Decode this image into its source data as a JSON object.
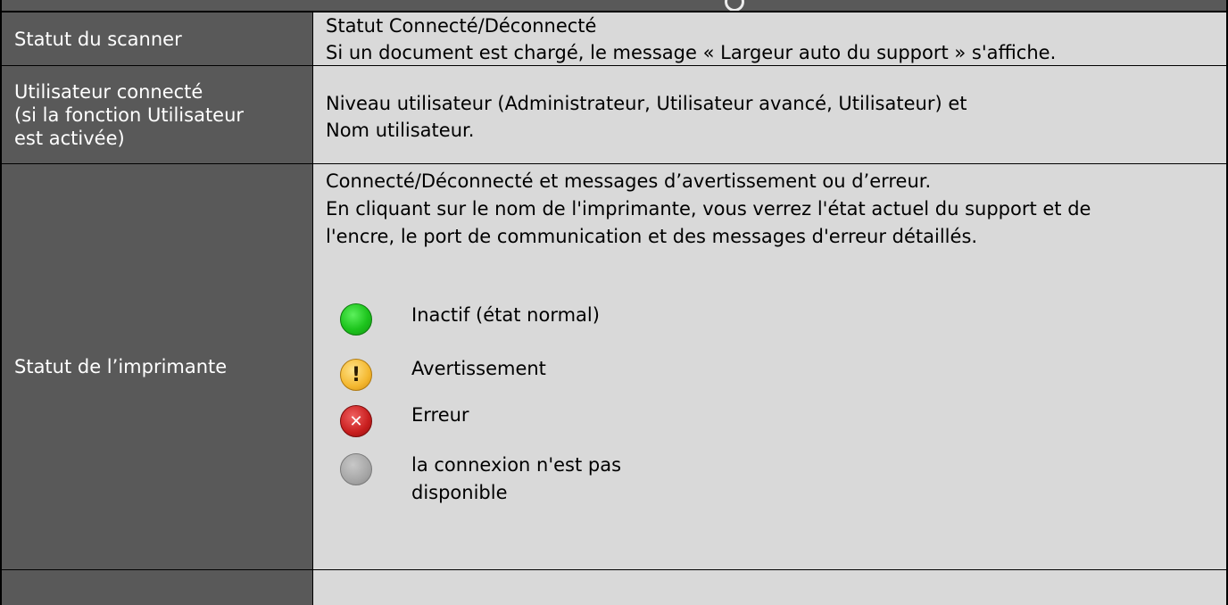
{
  "rows": [
    {
      "label_lines": [
        "Statut du scanner"
      ],
      "description_lines": [
        "Statut Connecté/Déconnecté",
        "Si un document est chargé, le message « Largeur auto du support » s'affiche."
      ]
    },
    {
      "label_lines": [
        "Utilisateur connecté",
        "(si la fonction Utilisateur",
        "est activée)"
      ],
      "description_lines": [
        "Niveau utilisateur (Administrateur, Utilisateur avancé, Utilisateur) et",
        "Nom utilisateur."
      ]
    },
    {
      "label_lines": [
        "Statut de l’imprimante"
      ],
      "description_lines": [
        "Connecté/Déconnecté et messages d’avertissement ou d’erreur.",
        "En cliquant sur le nom de l'imprimante, vous verrez l'état actuel du support et de",
        "l'encre, le port de communication et des messages d'erreur détaillés."
      ],
      "status_items": [
        {
          "icon": "green-circle-icon",
          "color": "#1dc41d",
          "text_lines": [
            "Inactif (état normal)"
          ]
        },
        {
          "icon": "warning-icon",
          "color": "#f4b830",
          "text_lines": [
            "Avertissement"
          ]
        },
        {
          "icon": "error-icon",
          "color": "#c81e1e",
          "text_lines": [
            "Erreur"
          ]
        },
        {
          "icon": "gray-circle-icon",
          "color": "#a6a6a6",
          "text_lines": [
            "la connexion n'est pas",
            "disponible"
          ]
        }
      ]
    },
    {
      "label_lines": [],
      "description_lines": []
    }
  ],
  "colors": {
    "label_background": "#595959",
    "content_background": "#d9d9d9",
    "label_text": "#ffffff",
    "content_text": "#000000"
  }
}
